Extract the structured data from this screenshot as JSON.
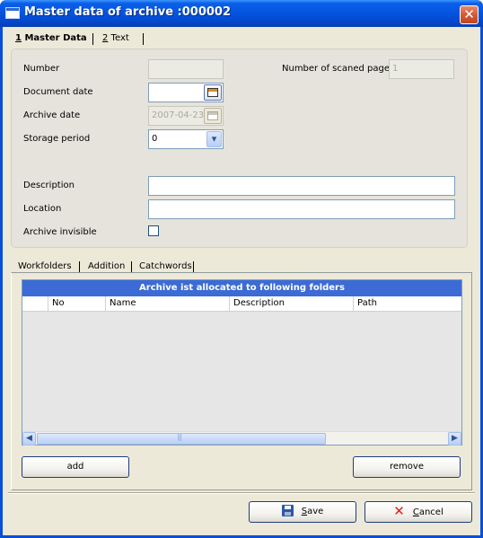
{
  "window": {
    "title": "Master data of archive :000002",
    "close_glyph": "✕"
  },
  "top_tabs": [
    {
      "key": "1",
      "label": " Master Data",
      "active": true
    },
    {
      "key": "2",
      "label": " Text",
      "active": false
    }
  ],
  "form": {
    "number_label": "Number",
    "number_value": "",
    "scanned_pages_label": "Number of scaned pages",
    "scanned_pages_value": "1",
    "document_date_label": "Document date",
    "document_date_value": "",
    "archive_date_label": "Archive date",
    "archive_date_value": "2007-04-23",
    "storage_period_label": "Storage period",
    "storage_period_value": "0",
    "description_label": "Description",
    "description_value": "",
    "location_label": "Location",
    "location_value": "",
    "archive_invisible_label": "Archive invisible",
    "archive_invisible_checked": false
  },
  "bottom_tabs": [
    "Workfolders",
    "Addition",
    "Catchwords"
  ],
  "grid": {
    "title": "Archive ist allocated to following folders",
    "columns": [
      "",
      "No",
      "Name",
      "Description",
      "Path"
    ],
    "rows": []
  },
  "buttons": {
    "add": "add",
    "remove": "remove",
    "save_key": "S",
    "save_rest": "ave",
    "cancel_key": "C",
    "cancel_rest": "ancel"
  },
  "icons": {
    "calendar": "calendar-icon",
    "dropdown": "chevron-down-icon",
    "save": "floppy-disk-icon",
    "cancel": "red-x-icon",
    "scroll_left": "◀",
    "scroll_right": "▶"
  }
}
